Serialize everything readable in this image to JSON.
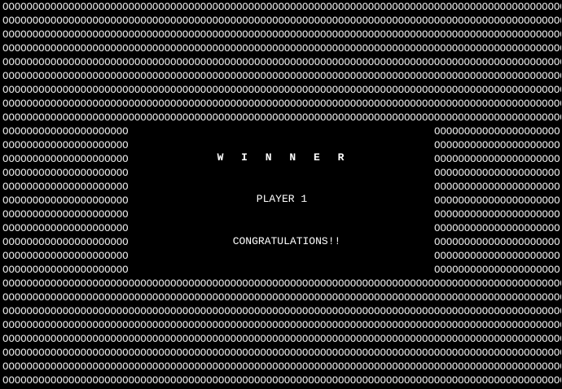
{
  "screen": {
    "background": "#000000",
    "text_color": "#ffffff",
    "pattern_char": "O"
  },
  "winner_panel": {
    "heading": "W I N N E R",
    "player": "PLAYER 1",
    "message": "CONGRATULATIONS!!"
  }
}
